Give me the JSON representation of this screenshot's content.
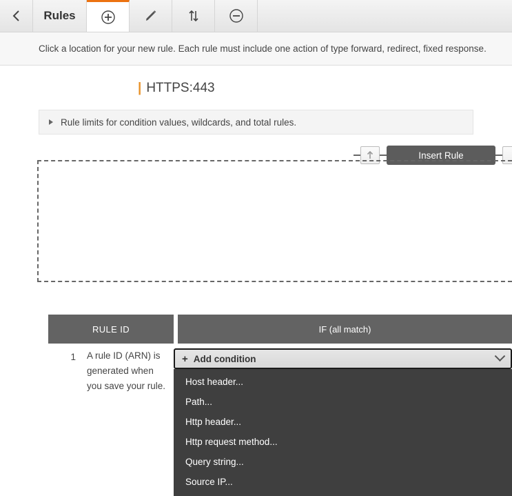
{
  "toolbar": {
    "back_label": "back-chevron",
    "title": "Rules",
    "buttons": [
      {
        "name": "add-rule-tab",
        "icon": "plus-circle-icon",
        "active": true
      },
      {
        "name": "edit-rules-tab",
        "icon": "pencil-icon",
        "active": false
      },
      {
        "name": "reorder-rules-tab",
        "icon": "sort-updown-icon",
        "active": false
      },
      {
        "name": "delete-rule-tab",
        "icon": "minus-circle-icon",
        "active": false
      }
    ]
  },
  "instruction": "Click a location for your new rule. Each rule must include one action of type forward, redirect, fixed response.",
  "listener": {
    "separator": "|",
    "label": "HTTPS:443"
  },
  "limits": {
    "text": "Rule limits for condition values, wildcards, and total rules."
  },
  "insert": {
    "move_up_label": "↑",
    "button_label": "Insert Rule"
  },
  "table": {
    "headers": {
      "rule_id": "RULE ID",
      "if": "IF (all match)"
    },
    "rows": [
      {
        "number": "1",
        "description": "A rule ID (ARN) is generated when you save your rule."
      }
    ]
  },
  "add_condition": {
    "plus": "+",
    "label": "Add condition",
    "options": [
      "Host header...",
      "Path...",
      "Http header...",
      "Http request method...",
      "Query string...",
      "Source IP..."
    ]
  },
  "colors": {
    "accent": "#ec7211",
    "header_gray": "#636363",
    "dropdown_bg": "#3f3f3f"
  }
}
